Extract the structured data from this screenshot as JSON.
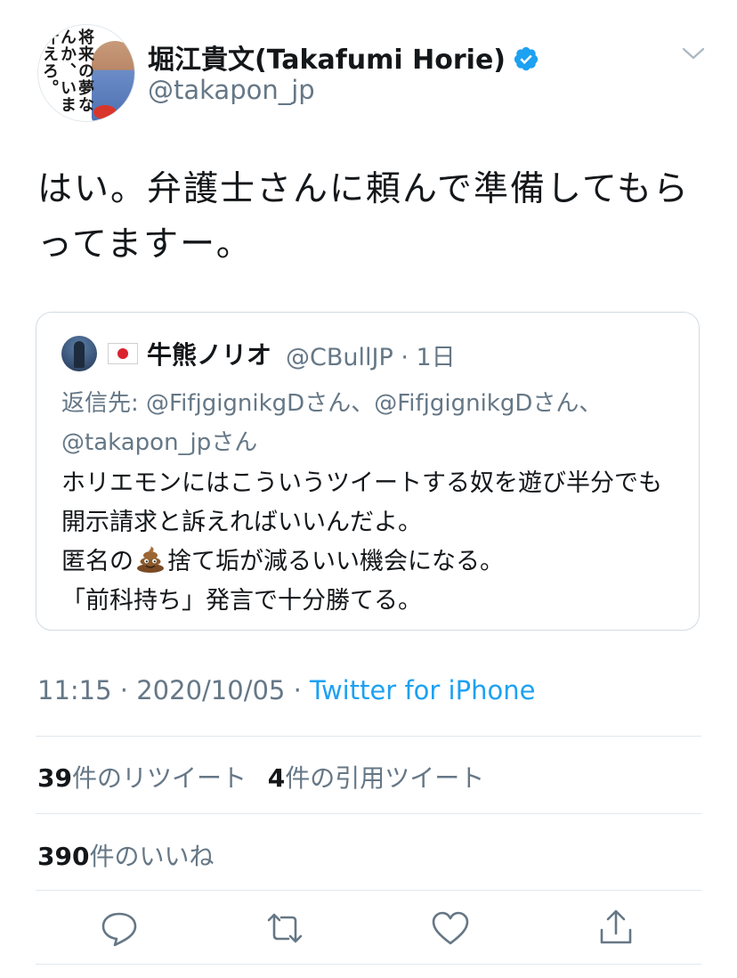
{
  "author": {
    "display_name": "堀江貴文(Takafumi Horie)",
    "handle": "@takapon_jp",
    "avatar_text": "将来の夢なんか、いま叶えろ。"
  },
  "tweet": {
    "text": "はい。弁護士さんに頼んで準備してもらってますー。"
  },
  "quoted_tweet": {
    "display_name": "牛熊ノリオ",
    "flag": "japan-flag",
    "handle_time": "@CBullJP · 1日",
    "reply_to": "返信先: @FifjgignikgDさん、@FifjgignikgDさん、@takapon_jpさん",
    "body_line1": "ホリエモンにはこういうツイートする奴を遊び半分でも開示請求と訴えればいいんだよ。",
    "body_line2_before": "匿名の",
    "body_line2_after": "捨て垢が減るいい機会になる。",
    "body_line3": "「前科持ち」発言で十分勝てる。"
  },
  "meta": {
    "time_date": "11:15 · 2020/10/05 · ",
    "source": "Twitter for iPhone"
  },
  "stats": {
    "retweets_count": "39",
    "retweets_label": "件のリツイート",
    "quotes_count": "4",
    "quotes_label": "件の引用ツイート",
    "likes_count": "390",
    "likes_label": "件のいいね"
  },
  "colors": {
    "accent": "#1da1f2",
    "text": "#14171a",
    "muted": "#657786",
    "border": "#e1e8ed"
  },
  "icons": {
    "reply": "reply-icon",
    "retweet": "retweet-icon",
    "like": "heart-icon",
    "share": "share-icon",
    "verified": "verified-badge-icon",
    "menu": "chevron-down-icon"
  }
}
